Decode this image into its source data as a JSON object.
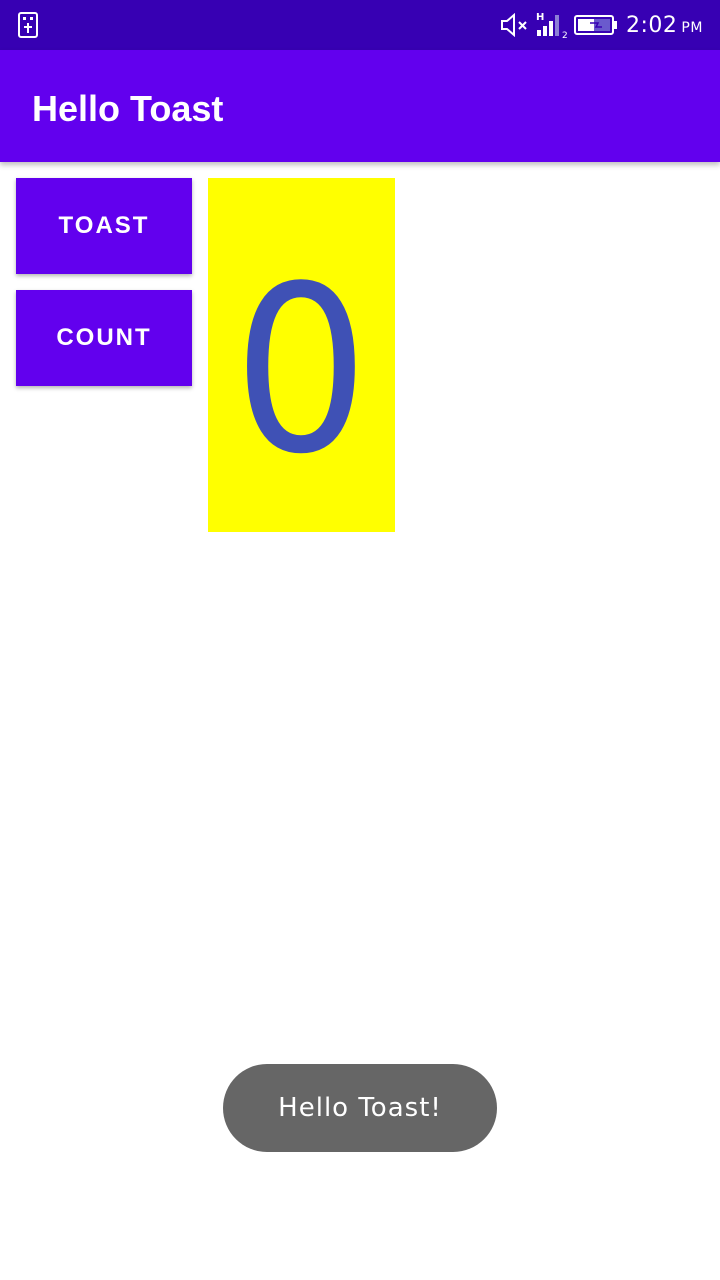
{
  "status_bar": {
    "time": "2:02",
    "ampm": "PM",
    "network_label": "H",
    "sim_slot": "2",
    "icons": [
      "usb-icon",
      "mute-icon",
      "signal-icon",
      "battery-icon"
    ]
  },
  "app_bar": {
    "title": "Hello Toast",
    "color": "#6200ee"
  },
  "buttons": {
    "toast_label": "TOAST",
    "count_label": "COUNT"
  },
  "count": {
    "value": "0",
    "background": "#ffff00",
    "text_color": "#3f51b5"
  },
  "toast": {
    "message": "Hello Toast!"
  }
}
